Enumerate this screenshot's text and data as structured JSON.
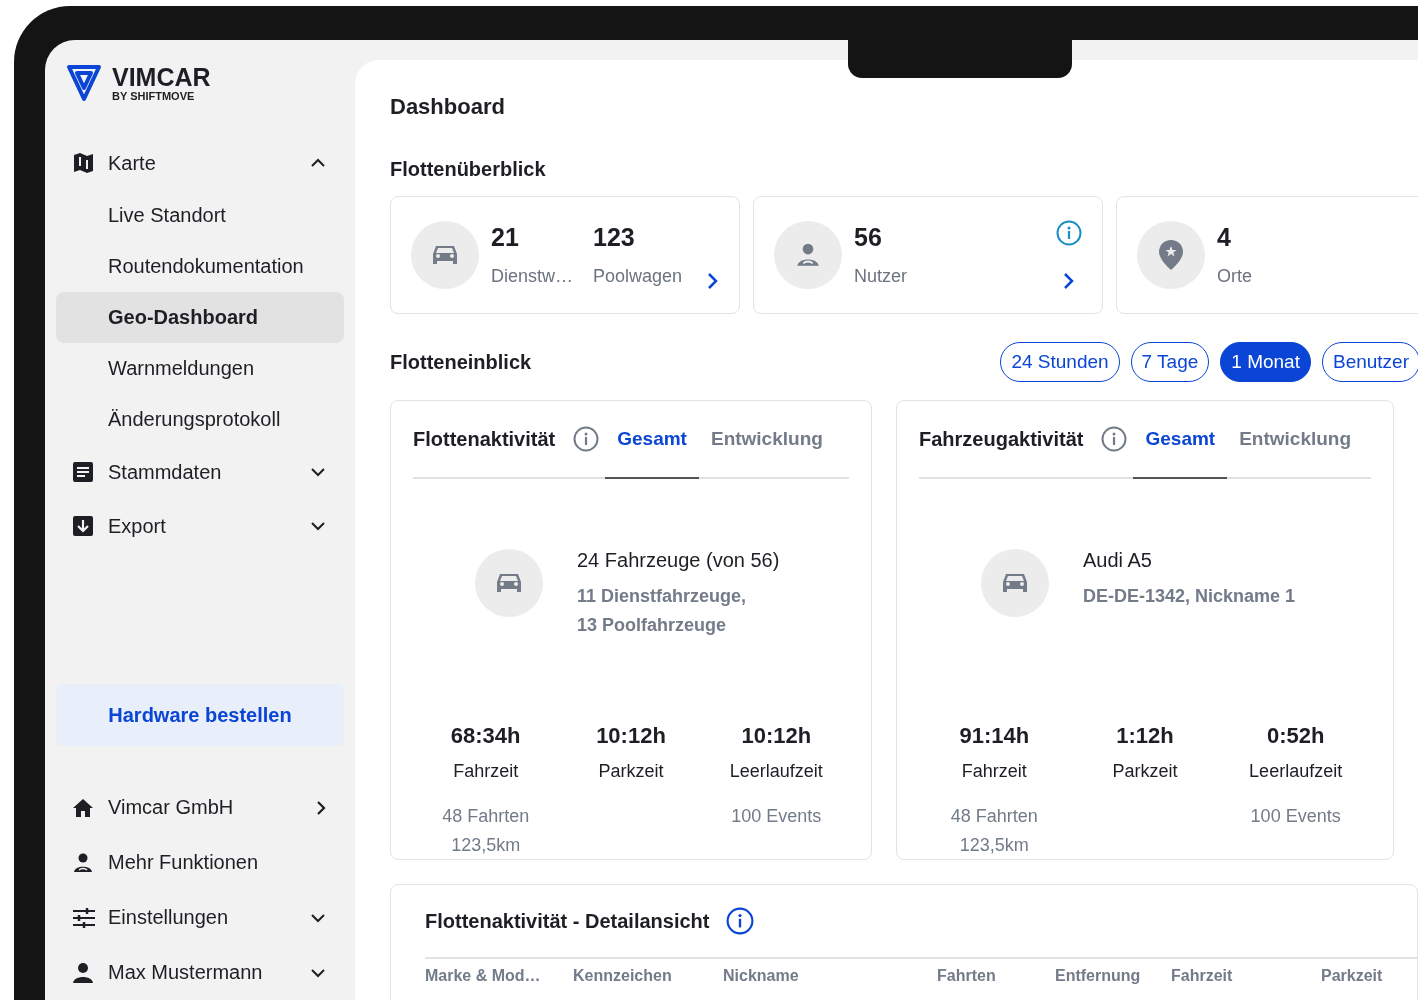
{
  "sidebar": {
    "logo": {
      "name": "VIMCAR",
      "tagline": "BY SHIFTMOVE"
    },
    "nav": [
      {
        "label": "Karte",
        "kind": "menu",
        "expanded": true,
        "children": [
          {
            "label": "Live Standort",
            "selected": false
          },
          {
            "label": "Routendokumentation",
            "selected": false
          },
          {
            "label": "Geo-Dashboard",
            "selected": true
          },
          {
            "label": "Warnmeldungen",
            "selected": false
          },
          {
            "label": "Änderungsprotokoll",
            "selected": false
          }
        ]
      },
      {
        "label": "Stammdaten",
        "kind": "menu",
        "expanded": false
      },
      {
        "label": "Export",
        "kind": "menu",
        "expanded": false
      }
    ],
    "hardware_button": "Hardware bestellen",
    "bottom": [
      {
        "label": "Vimcar GmbH",
        "kind": "link"
      },
      {
        "label": "Mehr Funktionen",
        "kind": "plain"
      },
      {
        "label": "Einstellungen",
        "kind": "menu",
        "expanded": false
      },
      {
        "label": "Max Mustermann",
        "kind": "menu",
        "expanded": false
      }
    ]
  },
  "main": {
    "title": "Dashboard",
    "overview": {
      "title": "Flottenüberblick",
      "cards": [
        {
          "stats": [
            {
              "value": "21",
              "label": "Dienstw…"
            },
            {
              "value": "123",
              "label": "Poolwagen"
            }
          ],
          "info": false,
          "arrow": true
        },
        {
          "stats": [
            {
              "value": "56",
              "label": "Nutzer"
            }
          ],
          "info": true,
          "arrow": true
        },
        {
          "stats": [
            {
              "value": "4",
              "label": "Orte"
            }
          ]
        }
      ]
    },
    "insight": {
      "title": "Flotteneinblick",
      "periods": [
        {
          "label": "24 Stunden",
          "selected": false
        },
        {
          "label": "7 Tage",
          "selected": false
        },
        {
          "label": "1 Monat",
          "selected": true
        },
        {
          "label": "Benutzer",
          "selected": false
        }
      ],
      "cards": [
        {
          "title": "Flottenaktivität",
          "tabs": [
            {
              "label": "Gesamt",
              "selected": true
            },
            {
              "label": "Entwicklung",
              "selected": false
            }
          ],
          "summary": {
            "title": "24 Fahrzeuge (von 56)",
            "lines": [
              "11 Dienstfahrzeuge,",
              "13 Poolfahrzeuge"
            ]
          },
          "metrics": [
            {
              "value": "68:34h",
              "label": "Fahrzeit",
              "notes": [
                "48 Fahrten",
                "123,5km"
              ]
            },
            {
              "value": "10:12h",
              "label": "Parkzeit"
            },
            {
              "value": "10:12h",
              "label": "Leerlaufzeit",
              "notes": [
                "100 Events"
              ]
            }
          ]
        },
        {
          "title": "Fahrzeugaktivität",
          "tabs": [
            {
              "label": "Gesamt",
              "selected": true
            },
            {
              "label": "Entwicklung",
              "selected": false
            }
          ],
          "summary": {
            "title": "Audi A5",
            "lines": [
              "DE-DE-1342, Nickname 1"
            ]
          },
          "metrics": [
            {
              "value": "91:14h",
              "label": "Fahrzeit",
              "notes": [
                "48 Fahrten",
                "123,5km"
              ]
            },
            {
              "value": "1:12h",
              "label": "Parkzeit"
            },
            {
              "value": "0:52h",
              "label": "Leerlaufzeit",
              "notes": [
                "100 Events"
              ]
            }
          ]
        }
      ]
    },
    "detail": {
      "title": "Flottenaktivität - Detailansicht",
      "columns": [
        "Marke & Mod…",
        "Kennzeichen",
        "Nickname",
        "Fahrten",
        "Entfernung",
        "Fahrzeit",
        "Parkzeit"
      ]
    }
  }
}
